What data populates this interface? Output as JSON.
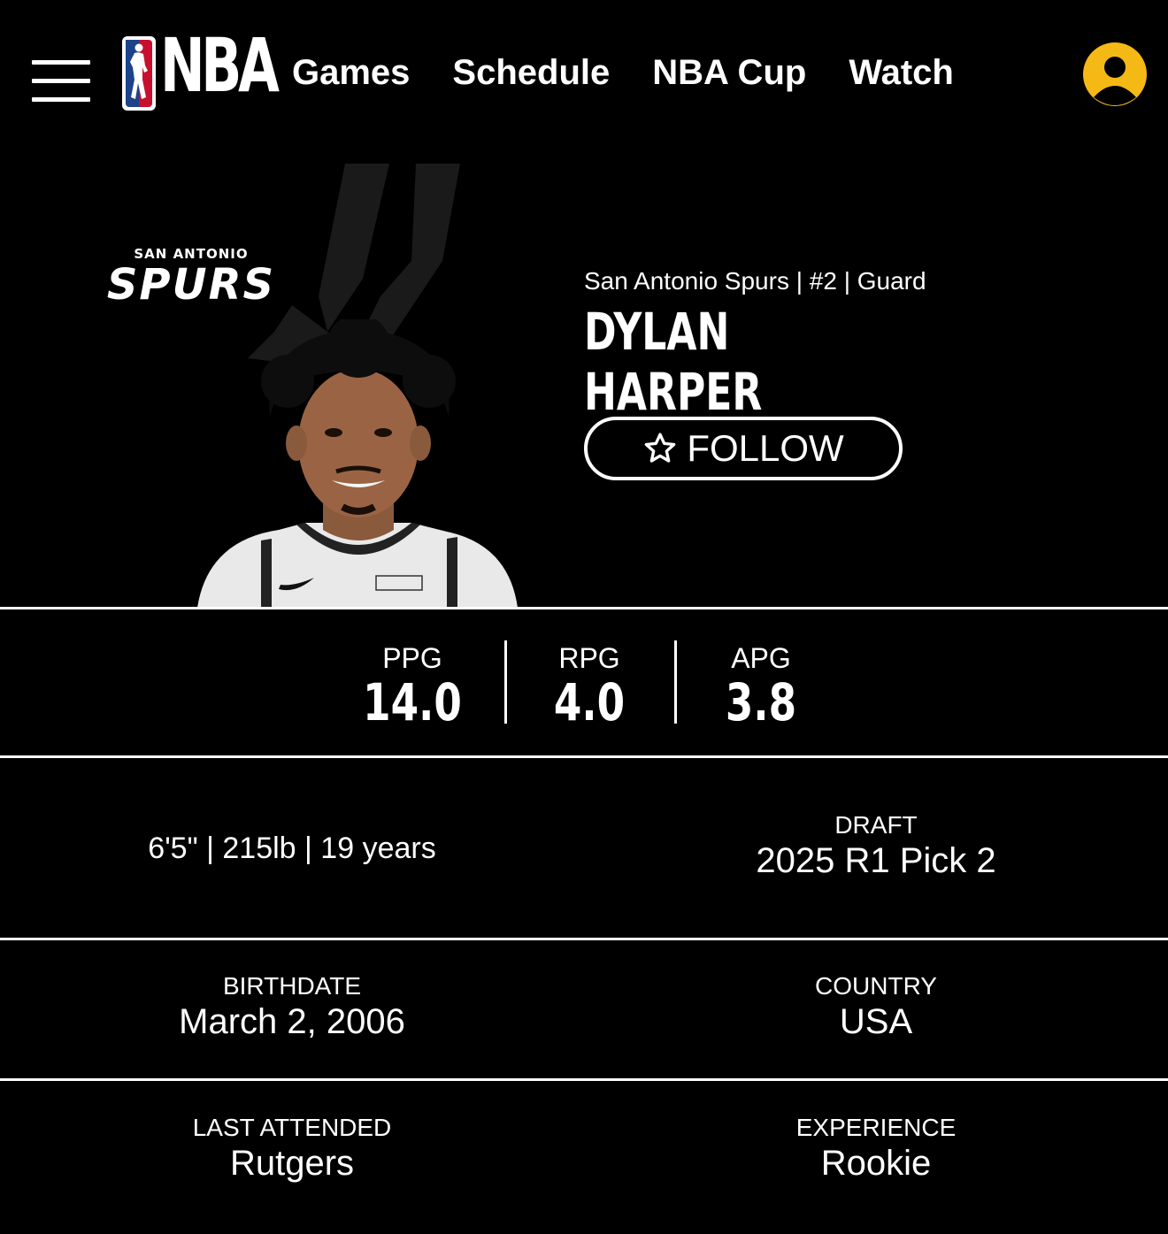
{
  "nav": {
    "brand": "NBA",
    "links": [
      "Games",
      "Schedule",
      "NBA Cup",
      "Watch"
    ]
  },
  "team_logo": {
    "top_text": "SAN ANTONIO",
    "main_text": "SPURS"
  },
  "player": {
    "meta": "San Antonio Spurs | #2 | Guard",
    "first_name": "DYLAN",
    "last_name": "HARPER",
    "follow_label": "FOLLOW"
  },
  "stats": [
    {
      "label": "PPG",
      "value": "14.0"
    },
    {
      "label": "RPG",
      "value": "4.0"
    },
    {
      "label": "APG",
      "value": "3.8"
    }
  ],
  "info": {
    "physical": "6'5\" | 215lb | 19 years",
    "draft_label": "DRAFT",
    "draft_value": "2025 R1 Pick 2",
    "birthdate_label": "BIRTHDATE",
    "birthdate_value": "March 2, 2006",
    "country_label": "COUNTRY",
    "country_value": "USA",
    "school_label": "LAST ATTENDED",
    "school_value": "Rutgers",
    "experience_label": "EXPERIENCE",
    "experience_value": "Rookie"
  },
  "colors": {
    "background": "#000000",
    "text": "#ffffff",
    "avatar_accent": "#f5b915",
    "nba_blue": "#1d428a",
    "nba_red": "#c8102e"
  },
  "icons": [
    "menu-icon",
    "nba-logo",
    "user-icon",
    "star-icon",
    "spurs-logo"
  ]
}
